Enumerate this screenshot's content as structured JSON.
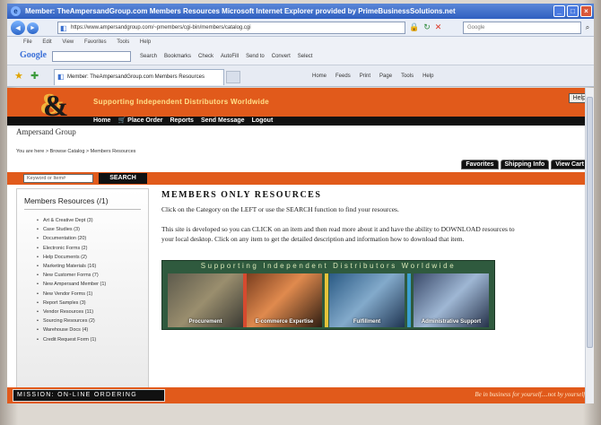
{
  "window": {
    "title": "Member: TheAmpersandGroup.com   Members Resources   Microsoft Internet Explorer provided by PrimeBusinessSolutions.net"
  },
  "addressbar": {
    "url": "https://www.ampersandgroup.com/~pmembers/cgi-bin/members/catalog.cgi",
    "search_placeholder": "Google"
  },
  "menubar": [
    "File",
    "Edit",
    "View",
    "Favorites",
    "Tools",
    "Help"
  ],
  "google_toolbar": {
    "logo": "Google",
    "items": [
      "Search",
      "Bookmarks",
      "Check",
      "AutoFill",
      "Send to",
      "Convert",
      "Select"
    ]
  },
  "tab": {
    "label": "Member: TheAmpersandGroup.com   Members Resources"
  },
  "commandbar": [
    "Home",
    "Feeds",
    "Print",
    "Page",
    "Tools",
    "Help"
  ],
  "site": {
    "tagline": "Supporting Independent Distributors Worldwide",
    "help": "Help",
    "logo_symbol": "&",
    "brand": "Ampersand Group",
    "nav": [
      "Home",
      "Place Order",
      "Reports",
      "Send Message",
      "Logout"
    ],
    "breadcrumb": "You are here > Browse Catalog > Members Resources",
    "right_tabs": [
      "Favorites",
      "Shipping Info",
      "View Cart"
    ],
    "search": {
      "placeholder": "Keyword or Item#",
      "button": "SEARCH"
    },
    "sidebar": {
      "title": "Members Resources (/1)",
      "items": [
        "Art & Creative Dept (3)",
        "Case Studies (3)",
        "Documentation (20)",
        "Electronic Forms (2)",
        "Help Documents (2)",
        "Marketing Materials (16)",
        "New Customer Forms (7)",
        "New Ampersand Member (1)",
        "New Vendor Forms (1)",
        "Report Samples (3)",
        "Vendor Resources (11)",
        "Sourcing Resources (2)",
        "Warehouse Docs (4)",
        "Credit Request Form (1)"
      ]
    },
    "main": {
      "title": "MEMBERS ONLY RESOURCES",
      "p1": "Click on the Category on the LEFT or use the SEARCH function to find your resources.",
      "p2": "This site is developed so you can CLICK on an item and then read more about it and have the ability to DOWNLOAD resources to your local desktop. Click on any item to get the detailed description and information how to download that item."
    },
    "banner": {
      "title": "Supporting Independent Distributors Worldwide",
      "panels": [
        "Procurement",
        "E-commerce Expertise",
        "Fulfillment",
        "Administrative Support"
      ]
    },
    "mission": "MISSION: ON-LINE ORDERING",
    "motto": "Be in business for yourself....not by yourself."
  }
}
